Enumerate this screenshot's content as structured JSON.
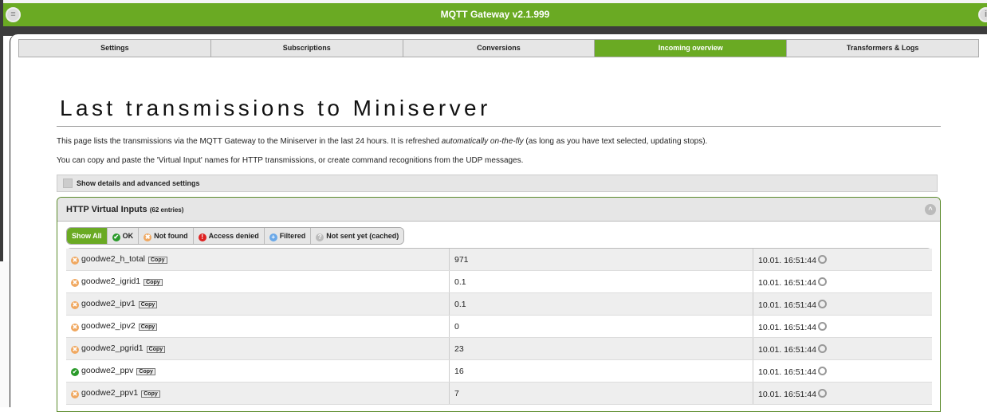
{
  "header": {
    "title": "MQTT Gateway v2.1.999",
    "menu_icon": "menu-icon",
    "info_icon": "info-icon"
  },
  "tabs": [
    {
      "label": "Settings"
    },
    {
      "label": "Subscriptions"
    },
    {
      "label": "Conversions"
    },
    {
      "label": "Incoming overview",
      "active": true
    },
    {
      "label": "Transformers & Logs"
    }
  ],
  "page": {
    "title": "Last transmissions to Miniserver",
    "intro1_a": "This page lists the transmissions via the MQTT Gateway to the Miniserver in the last 24 hours. It is refreshed ",
    "intro1_em": "automatically on-the-fly",
    "intro1_b": " (as long as you have text selected, updating stops).",
    "intro2": "You can copy and paste the 'Virtual Input' names for HTTP transmissions, or create command recognitions from the UDP messages.",
    "details_label": "Show details and advanced settings"
  },
  "panel": {
    "title": "HTTP Virtual Inputs",
    "count": "(62 entries)"
  },
  "filters": [
    {
      "label": "Show All",
      "icon": "",
      "active": true
    },
    {
      "label": "OK",
      "icon": "✔",
      "color": "#2a9a2a"
    },
    {
      "label": "Not found",
      "icon": "✖",
      "color": "#f0a860"
    },
    {
      "label": "Access denied",
      "icon": "!",
      "color": "#dd2222"
    },
    {
      "label": "Filtered",
      "icon": "+",
      "color": "#6aa8e8"
    },
    {
      "label": "Not sent yet (cached)",
      "icon": "?",
      "color": "#bbbbbb"
    }
  ],
  "copy_label": "Copy",
  "rows": [
    {
      "name": "goodwe2_h_total",
      "value": "971",
      "time": "10.01. 16:51:44",
      "status": "not-found"
    },
    {
      "name": "goodwe2_igrid1",
      "value": "0.1",
      "time": "10.01. 16:51:44",
      "status": "not-found"
    },
    {
      "name": "goodwe2_ipv1",
      "value": "0.1",
      "time": "10.01. 16:51:44",
      "status": "not-found"
    },
    {
      "name": "goodwe2_ipv2",
      "value": "0",
      "time": "10.01. 16:51:44",
      "status": "not-found"
    },
    {
      "name": "goodwe2_pgrid1",
      "value": "23",
      "time": "10.01. 16:51:44",
      "status": "not-found"
    },
    {
      "name": "goodwe2_ppv",
      "value": "16",
      "time": "10.01. 16:51:44",
      "status": "ok"
    },
    {
      "name": "goodwe2_ppv1",
      "value": "7",
      "time": "10.01. 16:51:44",
      "status": "not-found"
    }
  ],
  "colors": {
    "accent": "#6aaa23",
    "ok": "#2a9a2a",
    "not_found": "#f0a860"
  }
}
